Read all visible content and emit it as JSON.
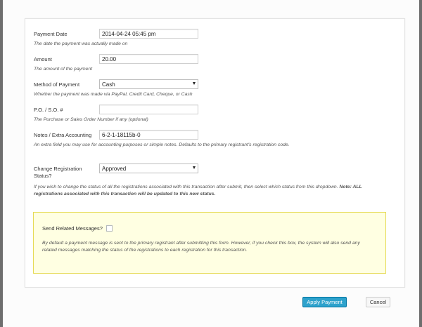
{
  "form": {
    "payment_date": {
      "label": "Payment Date",
      "value": "2014-04-24 05:45 pm",
      "description": "The date the payment was actually made on"
    },
    "amount": {
      "label": "Amount",
      "value": "20.00",
      "description": "The amount of the payment"
    },
    "method": {
      "label": "Method of Payment",
      "value": "Cash",
      "description": "Whether the payment was made via PayPal, Credit Card, Cheque, or Cash"
    },
    "po": {
      "label": "P.O. / S.O. #",
      "value": "",
      "description": "The Purchase or Sales Order Number if any (optional)"
    },
    "notes": {
      "label": "Notes / Extra Accounting",
      "value": "6-2-1-18115b-0",
      "description": "An extra field you may use for accounting purposes or simple notes. Defaults to the primary registrant's registration code."
    },
    "status": {
      "label_line1": "Change Registration",
      "label_line2": "Status?",
      "value": "Approved",
      "description_part1": "If you wish to change the status of all the registrations associated with this transaction after submit, then select which status from this dropdown.",
      "description_strong1": "Note: ALL",
      "description_strong2": "registrations associated with this transaction will be updated to this new status."
    },
    "messages": {
      "label": "Send Related Messages?",
      "checked": false,
      "description_line1": "By default a payment message is sent to the primary registrant after submitting this form. However, if you check this box, the system will also send any",
      "description_line2": "related messages matching the status of the registrations to each registration for this transaction."
    }
  },
  "actions": {
    "apply_label": "Apply Payment",
    "cancel_label": "Cancel"
  }
}
